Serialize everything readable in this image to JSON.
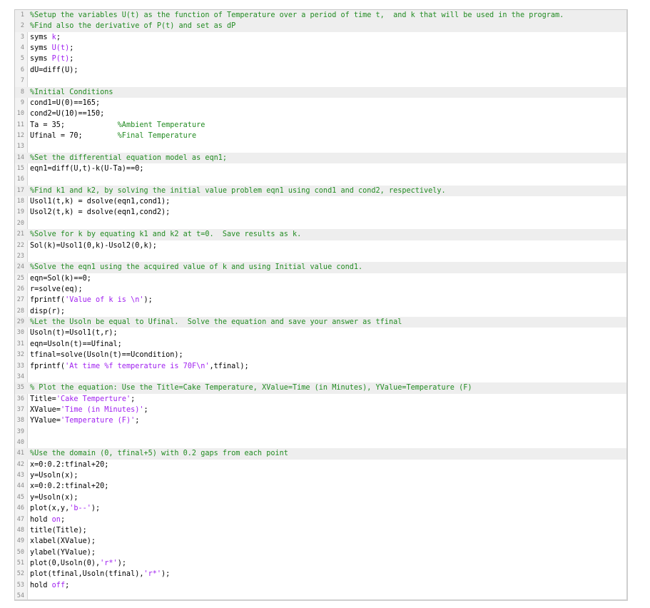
{
  "editor": {
    "language": "MATLAB",
    "colors": {
      "comment": "#228b22",
      "string": "#a020f0",
      "symbol": "#a020f0",
      "comment_line_background": "#eeeeee",
      "line_number": "#8a8a8a"
    },
    "lines": [
      {
        "n": "1",
        "type": "comment",
        "segments": [
          {
            "t": "%Setup the variables U(t) as the function of Temperature over a period of time t,  and k that will be used in the program.",
            "c": "c"
          }
        ]
      },
      {
        "n": "2",
        "type": "comment",
        "segments": [
          {
            "t": "%Find also the derivative of P(t) and set as dP",
            "c": "c"
          }
        ]
      },
      {
        "n": "3",
        "type": "code",
        "segments": [
          {
            "t": "syms ",
            "c": ""
          },
          {
            "t": "k",
            "c": "k"
          },
          {
            "t": ";",
            "c": ""
          }
        ]
      },
      {
        "n": "4",
        "type": "code",
        "segments": [
          {
            "t": "syms ",
            "c": ""
          },
          {
            "t": "U(t)",
            "c": "k"
          },
          {
            "t": ";",
            "c": ""
          }
        ]
      },
      {
        "n": "5",
        "type": "code",
        "segments": [
          {
            "t": "syms ",
            "c": ""
          },
          {
            "t": "P(t)",
            "c": "k"
          },
          {
            "t": ";",
            "c": ""
          }
        ]
      },
      {
        "n": "6",
        "type": "code",
        "segments": [
          {
            "t": "dU=diff(U);",
            "c": ""
          }
        ]
      },
      {
        "n": "7",
        "type": "blank",
        "segments": []
      },
      {
        "n": "8",
        "type": "comment",
        "segments": [
          {
            "t": "%Initial Conditions",
            "c": "c"
          }
        ]
      },
      {
        "n": "9",
        "type": "code",
        "segments": [
          {
            "t": "cond1=U(0)==165;",
            "c": ""
          }
        ]
      },
      {
        "n": "10",
        "type": "code",
        "segments": [
          {
            "t": "cond2=U(10)==150;",
            "c": ""
          }
        ]
      },
      {
        "n": "11",
        "type": "code",
        "segments": [
          {
            "t": "Ta = 35;            ",
            "c": ""
          },
          {
            "t": "%Ambient Temperature",
            "c": "c"
          }
        ]
      },
      {
        "n": "12",
        "type": "code",
        "segments": [
          {
            "t": "Ufinal = 70;        ",
            "c": ""
          },
          {
            "t": "%Final Temperature",
            "c": "c"
          }
        ]
      },
      {
        "n": "13",
        "type": "blank",
        "segments": []
      },
      {
        "n": "14",
        "type": "comment",
        "segments": [
          {
            "t": "%Set the differential equation model as eqn1;",
            "c": "c"
          }
        ]
      },
      {
        "n": "15",
        "type": "code",
        "segments": [
          {
            "t": "eqn1=diff(U,t)-k(U-Ta)==0;",
            "c": ""
          }
        ]
      },
      {
        "n": "16",
        "type": "blank",
        "segments": []
      },
      {
        "n": "17",
        "type": "comment",
        "segments": [
          {
            "t": "%Find k1 and k2, by solving the initial value problem eqn1 using cond1 and cond2, respectively.",
            "c": "c"
          }
        ]
      },
      {
        "n": "18",
        "type": "code",
        "segments": [
          {
            "t": "Usol1(t,k) = dsolve(eqn1,cond1);",
            "c": ""
          }
        ]
      },
      {
        "n": "19",
        "type": "code",
        "segments": [
          {
            "t": "Usol2(t,k) = dsolve(eqn1,cond2);",
            "c": ""
          }
        ]
      },
      {
        "n": "20",
        "type": "blank",
        "segments": []
      },
      {
        "n": "21",
        "type": "comment",
        "segments": [
          {
            "t": "%Solve for k by equating k1 and k2 at t=0.  Save results as k.",
            "c": "c"
          }
        ]
      },
      {
        "n": "22",
        "type": "code",
        "segments": [
          {
            "t": "Sol(k)=Usol1(0,k)-Usol2(0,k);",
            "c": ""
          }
        ]
      },
      {
        "n": "23",
        "type": "blank",
        "segments": []
      },
      {
        "n": "24",
        "type": "comment",
        "segments": [
          {
            "t": "%Solve the eqn1 using the acquired value of k and using Initial value cond1.",
            "c": "c"
          }
        ]
      },
      {
        "n": "25",
        "type": "code",
        "segments": [
          {
            "t": "eqn=Sol(k)==0;",
            "c": ""
          }
        ]
      },
      {
        "n": "26",
        "type": "code",
        "segments": [
          {
            "t": "r=solve(eq);",
            "c": ""
          }
        ]
      },
      {
        "n": "27",
        "type": "code",
        "segments": [
          {
            "t": "fprintf(",
            "c": ""
          },
          {
            "t": "'Value of k is \\n'",
            "c": "s"
          },
          {
            "t": ");",
            "c": ""
          }
        ]
      },
      {
        "n": "28",
        "type": "code",
        "segments": [
          {
            "t": "disp(r);",
            "c": ""
          }
        ]
      },
      {
        "n": "29",
        "type": "comment",
        "segments": [
          {
            "t": "%Let the Usoln be equal to Ufinal.  Solve the equation and save your answer as tfinal",
            "c": "c"
          }
        ]
      },
      {
        "n": "30",
        "type": "code",
        "segments": [
          {
            "t": "Usoln(t)=Usol1(t,r);",
            "c": ""
          }
        ]
      },
      {
        "n": "31",
        "type": "code",
        "segments": [
          {
            "t": "eqn=Usoln(t)==Ufinal;",
            "c": ""
          }
        ]
      },
      {
        "n": "32",
        "type": "code",
        "segments": [
          {
            "t": "tfinal=solve(Usoln(t)==Ucondition);",
            "c": ""
          }
        ]
      },
      {
        "n": "33",
        "type": "code",
        "segments": [
          {
            "t": "fprintf(",
            "c": ""
          },
          {
            "t": "'At time %f temperature is 70F\\n'",
            "c": "s"
          },
          {
            "t": ",tfinal);",
            "c": ""
          }
        ]
      },
      {
        "n": "34",
        "type": "blank",
        "segments": []
      },
      {
        "n": "35",
        "type": "comment",
        "segments": [
          {
            "t": "% Plot the equation: Use the Title=Cake Temperature, XValue=Time (in Minutes), YValue=Temperature (F)",
            "c": "c"
          }
        ]
      },
      {
        "n": "36",
        "type": "code",
        "segments": [
          {
            "t": "Title=",
            "c": ""
          },
          {
            "t": "'Cake Temperture'",
            "c": "s"
          },
          {
            "t": ";",
            "c": ""
          }
        ]
      },
      {
        "n": "37",
        "type": "code",
        "segments": [
          {
            "t": "XValue=",
            "c": ""
          },
          {
            "t": "'Time (in Minutes)'",
            "c": "s"
          },
          {
            "t": ";",
            "c": ""
          }
        ]
      },
      {
        "n": "38",
        "type": "code",
        "segments": [
          {
            "t": "YValue=",
            "c": ""
          },
          {
            "t": "'Temperature (F)'",
            "c": "s"
          },
          {
            "t": ";",
            "c": ""
          }
        ]
      },
      {
        "n": "39",
        "type": "blank",
        "segments": []
      },
      {
        "n": "40",
        "type": "blank",
        "segments": []
      },
      {
        "n": "41",
        "type": "comment",
        "segments": [
          {
            "t": "%Use the domain (0, tfinal+5) with 0.2 gaps from each point",
            "c": "c"
          }
        ]
      },
      {
        "n": "42",
        "type": "code",
        "segments": [
          {
            "t": "x=0:0.2:tfinal+20;",
            "c": ""
          }
        ]
      },
      {
        "n": "43",
        "type": "code",
        "segments": [
          {
            "t": "y=Usoln(x);",
            "c": ""
          }
        ]
      },
      {
        "n": "44",
        "type": "code",
        "segments": [
          {
            "t": "x=0:0.2:tfinal+20;",
            "c": ""
          }
        ]
      },
      {
        "n": "45",
        "type": "code",
        "segments": [
          {
            "t": "y=Usoln(x);",
            "c": ""
          }
        ]
      },
      {
        "n": "46",
        "type": "code",
        "segments": [
          {
            "t": "plot(x,y,",
            "c": ""
          },
          {
            "t": "'b--'",
            "c": "s"
          },
          {
            "t": ");",
            "c": ""
          }
        ]
      },
      {
        "n": "47",
        "type": "code",
        "segments": [
          {
            "t": "hold ",
            "c": ""
          },
          {
            "t": "on",
            "c": "k"
          },
          {
            "t": ";",
            "c": ""
          }
        ]
      },
      {
        "n": "48",
        "type": "code",
        "segments": [
          {
            "t": "title(Title);",
            "c": ""
          }
        ]
      },
      {
        "n": "49",
        "type": "code",
        "segments": [
          {
            "t": "xlabel(XValue);",
            "c": ""
          }
        ]
      },
      {
        "n": "50",
        "type": "code",
        "segments": [
          {
            "t": "ylabel(YValue);",
            "c": ""
          }
        ]
      },
      {
        "n": "51",
        "type": "code",
        "segments": [
          {
            "t": "plot(0,Usoln(0),",
            "c": ""
          },
          {
            "t": "'r*'",
            "c": "s"
          },
          {
            "t": ");",
            "c": ""
          }
        ]
      },
      {
        "n": "52",
        "type": "code",
        "segments": [
          {
            "t": "plot(tfinal,Usoln(tfinal),",
            "c": ""
          },
          {
            "t": "'r*'",
            "c": "s"
          },
          {
            "t": ");",
            "c": ""
          }
        ]
      },
      {
        "n": "53",
        "type": "code",
        "segments": [
          {
            "t": "hold ",
            "c": ""
          },
          {
            "t": "off",
            "c": "k"
          },
          {
            "t": ";",
            "c": ""
          }
        ]
      },
      {
        "n": "54",
        "type": "blank",
        "segments": []
      }
    ]
  }
}
